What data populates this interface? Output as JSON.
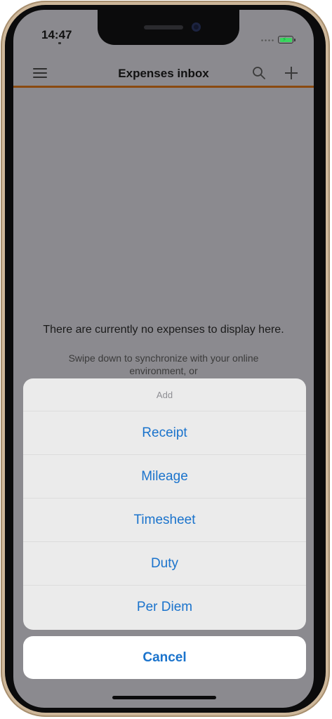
{
  "status": {
    "time": "14:47"
  },
  "navbar": {
    "title": "Expenses inbox"
  },
  "empty": {
    "title": "There are currently no expenses to display here.",
    "subtitle": "Swipe down to synchronize with your online environment, or"
  },
  "sheet": {
    "header": "Add",
    "items": [
      {
        "label": "Receipt"
      },
      {
        "label": "Mileage"
      },
      {
        "label": "Timesheet"
      },
      {
        "label": "Duty"
      },
      {
        "label": "Per Diem"
      }
    ],
    "cancel": "Cancel"
  },
  "colors": {
    "accent": "#8a4a10",
    "action_blue": "#1a73cc",
    "overlay": "#8b8a8f"
  }
}
